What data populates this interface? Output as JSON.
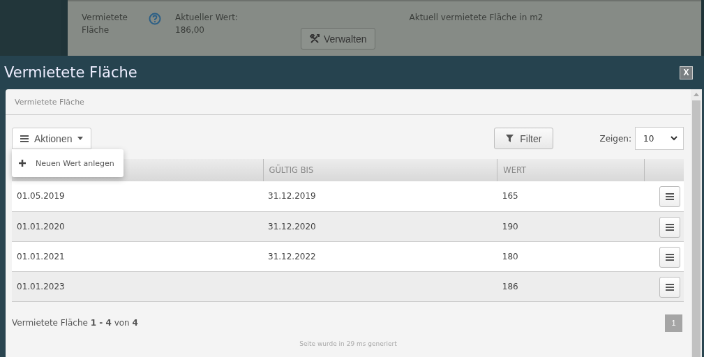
{
  "background_page": {
    "field_label": "Vermietete Fläche",
    "current_value_label": "Aktueller Wert:",
    "current_value": "186,00",
    "manage_button": "Verwalten",
    "description": "Aktuell vermietete Fläche in m2"
  },
  "dialog": {
    "title": "Vermietete Fläche",
    "close_button": "X",
    "panel_title": "Vermietete Fläche",
    "actions_button": "Aktionen",
    "actions_menu": {
      "expanded": true,
      "items": [
        "Neuen Wert anlegen"
      ]
    },
    "filter_button": "Filter",
    "page_size_label": "Zeigen:",
    "page_size": "10",
    "table": {
      "header": {
        "column_2": "GÜLTIG BIS",
        "column_3": "WERT"
      },
      "rows": [
        {
          "column_1": "01.05.2019",
          "column_2": "31.12.2019",
          "column_3": "165"
        },
        {
          "column_1": "01.01.2020",
          "column_2": "31.12.2020",
          "column_3": "190"
        },
        {
          "column_1": "01.01.2021",
          "column_2": "31.12.2022",
          "column_3": "180"
        },
        {
          "column_1": "01.01.2023",
          "column_3": "186"
        }
      ]
    },
    "summary": "Vermietete Fläche **1 - 4** von **4**",
    "pages": [
      {
        "label": "1",
        "selected": true
      }
    ],
    "generated_note": "Seite wurde in 29 ms generiert"
  }
}
